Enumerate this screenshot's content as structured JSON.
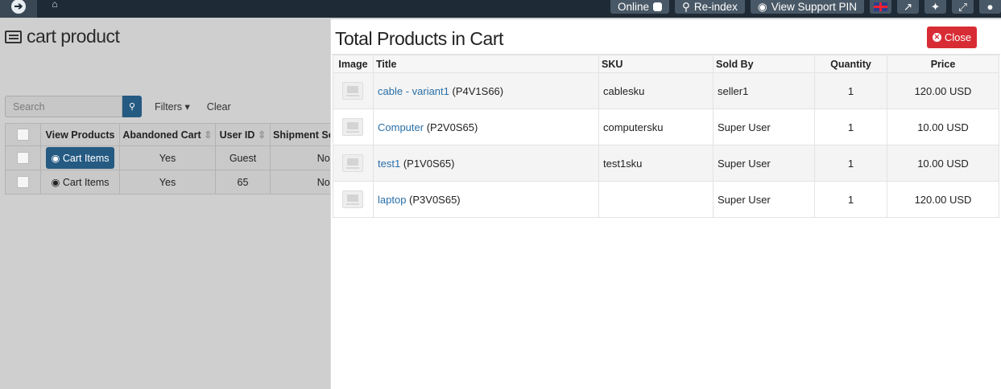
{
  "topbar": {
    "back_icon": "arrow-circle-right-icon",
    "home_icon": "home-icon",
    "online_label": "Online",
    "reindex_label": "Re-index",
    "support_pin_label": "View Support PIN",
    "language_icon": "uk-flag-icon",
    "external_icon": "external-link-icon",
    "joomla_icon": "joomla-icon",
    "fullscreen_icon": "expand-icon",
    "user_icon": "user-icon"
  },
  "background": {
    "title": "cart product",
    "search": {
      "placeholder": "Search"
    },
    "filters_label": "Filters",
    "clear_label": "Clear",
    "columns": [
      "View Products",
      "Abandoned Cart",
      "User ID",
      "Shipment Se"
    ],
    "rows": [
      {
        "view": "Cart Items",
        "abandoned": "Yes",
        "user_id": "Guest",
        "shipment": "No"
      },
      {
        "view": "Cart Items",
        "abandoned": "Yes",
        "user_id": "65",
        "shipment": "No"
      }
    ]
  },
  "modal": {
    "title": "Total Products in Cart",
    "close_label": "Close",
    "columns": {
      "image": "Image",
      "title": "Title",
      "sku": "SKU",
      "sold_by": "Sold By",
      "quantity": "Quantity",
      "price": "Price"
    },
    "rows": [
      {
        "name": "cable - variant1",
        "code": "(P4V1S66)",
        "sku": "cablesku",
        "sold_by": "seller1",
        "quantity": "1",
        "price": "120.00 USD"
      },
      {
        "name": "Computer",
        "code": "(P2V0S65)",
        "sku": "computersku",
        "sold_by": "Super User",
        "quantity": "1",
        "price": "10.00 USD"
      },
      {
        "name": "test1",
        "code": "(P1V0S65)",
        "sku": "test1sku",
        "sold_by": "Super User",
        "quantity": "1",
        "price": "10.00 USD"
      },
      {
        "name": "laptop",
        "code": "(P3V0S65)",
        "sku": "",
        "sold_by": "Super User",
        "quantity": "1",
        "price": "120.00 USD"
      }
    ]
  },
  "colors": {
    "primary": "#255a82",
    "danger": "#d82c35",
    "topbar": "#1e2a35",
    "link": "#2a6fa8"
  }
}
